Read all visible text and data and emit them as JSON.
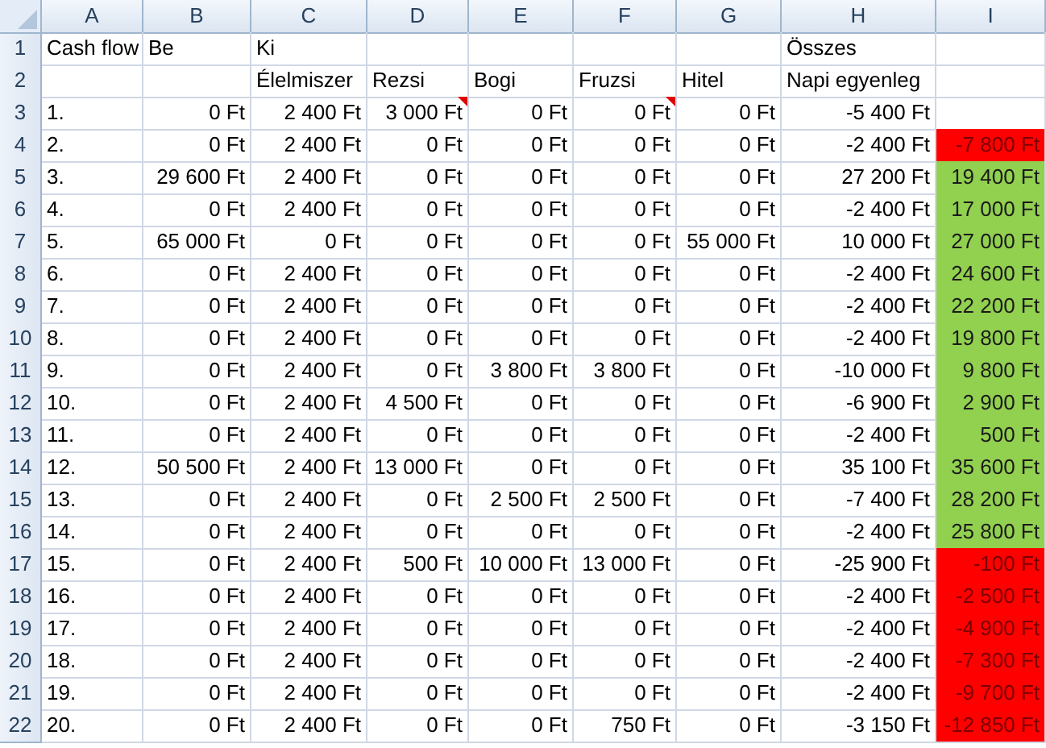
{
  "columns": [
    "A",
    "B",
    "C",
    "D",
    "E",
    "F",
    "G",
    "H",
    "I"
  ],
  "rows": [
    {
      "number": "1",
      "kind": "header",
      "cells": {
        "A": "Cash flow",
        "B": "Be",
        "C": "Ki",
        "H": "Összes"
      }
    },
    {
      "number": "2",
      "kind": "header",
      "cells": {
        "C": "Élelmiszer",
        "D": "Rezsi",
        "E": "Bogi",
        "F": "Fruzsi",
        "G": "Hitel",
        "H": "Napi egyenleg"
      }
    },
    {
      "number": "3",
      "kind": "data",
      "commented": {
        "D": true,
        "F": true
      },
      "cells": {
        "A": "1.",
        "B": "0 Ft",
        "C": "2 400 Ft",
        "D": "3 000 Ft",
        "E": "0 Ft",
        "F": "0 Ft",
        "G": "0 Ft",
        "H": "-5 400 Ft"
      }
    },
    {
      "number": "4",
      "kind": "data",
      "color": "#ff0000",
      "cells": {
        "A": "2.",
        "B": "0 Ft",
        "C": "2 400 Ft",
        "D": "0 Ft",
        "E": "0 Ft",
        "F": "0 Ft",
        "G": "0 Ft",
        "H": "-2 400 Ft",
        "I": "-7 800 Ft"
      }
    },
    {
      "number": "5",
      "kind": "data",
      "color": "#92d050",
      "cells": {
        "A": "3.",
        "B": "29 600 Ft",
        "C": "2 400 Ft",
        "D": "0 Ft",
        "E": "0 Ft",
        "F": "0 Ft",
        "G": "0 Ft",
        "H": "27 200 Ft",
        "I": "19 400 Ft"
      }
    },
    {
      "number": "6",
      "kind": "data",
      "color": "#92d050",
      "cells": {
        "A": "4.",
        "B": "0 Ft",
        "C": "2 400 Ft",
        "D": "0 Ft",
        "E": "0 Ft",
        "F": "0 Ft",
        "G": "0 Ft",
        "H": "-2 400 Ft",
        "I": "17 000 Ft"
      }
    },
    {
      "number": "7",
      "kind": "data",
      "color": "#92d050",
      "cells": {
        "A": "5.",
        "B": "65 000 Ft",
        "C": "0 Ft",
        "D": "0 Ft",
        "E": "0 Ft",
        "F": "0 Ft",
        "G": "55 000 Ft",
        "H": "10 000 Ft",
        "I": "27 000 Ft"
      }
    },
    {
      "number": "8",
      "kind": "data",
      "color": "#92d050",
      "cells": {
        "A": "6.",
        "B": "0 Ft",
        "C": "2 400 Ft",
        "D": "0 Ft",
        "E": "0 Ft",
        "F": "0 Ft",
        "G": "0 Ft",
        "H": "-2 400 Ft",
        "I": "24 600 Ft"
      }
    },
    {
      "number": "9",
      "kind": "data",
      "color": "#92d050",
      "cells": {
        "A": "7.",
        "B": "0 Ft",
        "C": "2 400 Ft",
        "D": "0 Ft",
        "E": "0 Ft",
        "F": "0 Ft",
        "G": "0 Ft",
        "H": "-2 400 Ft",
        "I": "22 200 Ft"
      }
    },
    {
      "number": "10",
      "kind": "data",
      "color": "#92d050",
      "cells": {
        "A": "8.",
        "B": "0 Ft",
        "C": "2 400 Ft",
        "D": "0 Ft",
        "E": "0 Ft",
        "F": "0 Ft",
        "G": "0 Ft",
        "H": "-2 400 Ft",
        "I": "19 800 Ft"
      }
    },
    {
      "number": "11",
      "kind": "data",
      "color": "#92d050",
      "cells": {
        "A": "9.",
        "B": "0 Ft",
        "C": "2 400 Ft",
        "D": "0 Ft",
        "E": "3 800 Ft",
        "F": "3 800 Ft",
        "G": "0 Ft",
        "H": "-10 000 Ft",
        "I": "9 800 Ft"
      }
    },
    {
      "number": "12",
      "kind": "data",
      "color": "#92d050",
      "cells": {
        "A": "10.",
        "B": "0 Ft",
        "C": "2 400 Ft",
        "D": "4 500 Ft",
        "E": "0 Ft",
        "F": "0 Ft",
        "G": "0 Ft",
        "H": "-6 900 Ft",
        "I": "2 900 Ft"
      }
    },
    {
      "number": "13",
      "kind": "data",
      "color": "#92d050",
      "cells": {
        "A": "11.",
        "B": "0 Ft",
        "C": "2 400 Ft",
        "D": "0 Ft",
        "E": "0 Ft",
        "F": "0 Ft",
        "G": "0 Ft",
        "H": "-2 400 Ft",
        "I": "500 Ft"
      }
    },
    {
      "number": "14",
      "kind": "data",
      "color": "#92d050",
      "cells": {
        "A": "12.",
        "B": "50 500 Ft",
        "C": "2 400 Ft",
        "D": "13 000 Ft",
        "E": "0 Ft",
        "F": "0 Ft",
        "G": "0 Ft",
        "H": "35 100 Ft",
        "I": "35 600 Ft"
      }
    },
    {
      "number": "15",
      "kind": "data",
      "color": "#92d050",
      "cells": {
        "A": "13.",
        "B": "0 Ft",
        "C": "2 400 Ft",
        "D": "0 Ft",
        "E": "2 500 Ft",
        "F": "2 500 Ft",
        "G": "0 Ft",
        "H": "-7 400 Ft",
        "I": "28 200 Ft"
      }
    },
    {
      "number": "16",
      "kind": "data",
      "color": "#92d050",
      "cells": {
        "A": "14.",
        "B": "0 Ft",
        "C": "2 400 Ft",
        "D": "0 Ft",
        "E": "0 Ft",
        "F": "0 Ft",
        "G": "0 Ft",
        "H": "-2 400 Ft",
        "I": "25 800 Ft"
      }
    },
    {
      "number": "17",
      "kind": "data",
      "color": "#ff0000",
      "cells": {
        "A": "15.",
        "B": "0 Ft",
        "C": "2 400 Ft",
        "D": "500 Ft",
        "E": "10 000 Ft",
        "F": "13 000 Ft",
        "G": "0 Ft",
        "H": "-25 900 Ft",
        "I": "-100 Ft"
      }
    },
    {
      "number": "18",
      "kind": "data",
      "color": "#ff0000",
      "cells": {
        "A": "16.",
        "B": "0 Ft",
        "C": "2 400 Ft",
        "D": "0 Ft",
        "E": "0 Ft",
        "F": "0 Ft",
        "G": "0 Ft",
        "H": "-2 400 Ft",
        "I": "-2 500 Ft"
      }
    },
    {
      "number": "19",
      "kind": "data",
      "color": "#ff0000",
      "cells": {
        "A": "17.",
        "B": "0 Ft",
        "C": "2 400 Ft",
        "D": "0 Ft",
        "E": "0 Ft",
        "F": "0 Ft",
        "G": "0 Ft",
        "H": "-2 400 Ft",
        "I": "-4 900 Ft"
      }
    },
    {
      "number": "20",
      "kind": "data",
      "color": "#ff0000",
      "cells": {
        "A": "18.",
        "B": "0 Ft",
        "C": "2 400 Ft",
        "D": "0 Ft",
        "E": "0 Ft",
        "F": "0 Ft",
        "G": "0 Ft",
        "H": "-2 400 Ft",
        "I": "-7 300 Ft"
      }
    },
    {
      "number": "21",
      "kind": "data",
      "color": "#ff0000",
      "cells": {
        "A": "19.",
        "B": "0 Ft",
        "C": "2 400 Ft",
        "D": "0 Ft",
        "E": "0 Ft",
        "F": "0 Ft",
        "G": "0 Ft",
        "H": "-2 400 Ft",
        "I": "-9 700 Ft"
      }
    },
    {
      "number": "22",
      "kind": "data",
      "color": "#ff0000",
      "cells": {
        "A": "20.",
        "B": "0 Ft",
        "C": "2 400 Ft",
        "D": "0 Ft",
        "E": "0 Ft",
        "F": "750 Ft",
        "G": "0 Ft",
        "H": "-3 150 Ft",
        "I": "-12 850 Ft"
      }
    }
  ]
}
